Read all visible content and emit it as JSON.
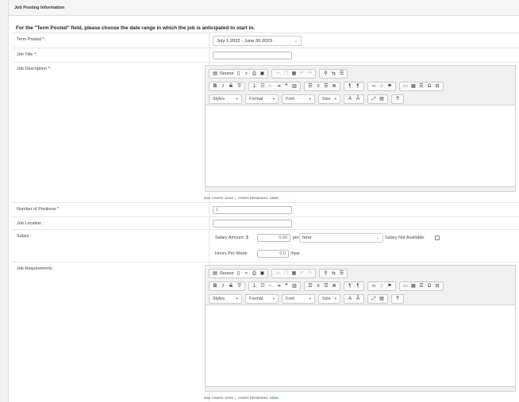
{
  "panel": {
    "title": "Job Posting Information"
  },
  "intro": "For the \"Term Posted\" field, please choose the date range in which the job is anticipated to start in.",
  "fields": {
    "term_posted": {
      "label": "Term Posted *:",
      "value": "July 1 2022 - June 30 2023"
    },
    "job_title": {
      "label": "Job Title *:",
      "value": ""
    },
    "job_description": {
      "label": "Job Description *:"
    },
    "num_positions": {
      "label": "Number of Positions *",
      "value": "1"
    },
    "job_location": {
      "label": "Job Location :",
      "value": ""
    },
    "salary": {
      "label": "Salary :",
      "amount_label": "Salary Amount: $",
      "amount_value": "0.00",
      "per_label": "per",
      "period_value": "hour",
      "not_available_label": "Salary Not Available:",
      "hours_label": "Hours Per Week:",
      "hours_value": "0.0",
      "hpw_label": "/hpw"
    },
    "job_requirements": {
      "label": "Job Requirements :"
    }
  },
  "editor": {
    "source_label": "Source",
    "styles_label": "Styles",
    "format_label": "Format",
    "font_label": "Font",
    "size_label": "Size",
    "bold": "B",
    "italic": "I",
    "strike": "S",
    "help": "?",
    "max_chars_label": "MAX CHARS: 10000",
    "remaining_label": "CHARS REMAINING:",
    "remaining_value": "10000"
  }
}
